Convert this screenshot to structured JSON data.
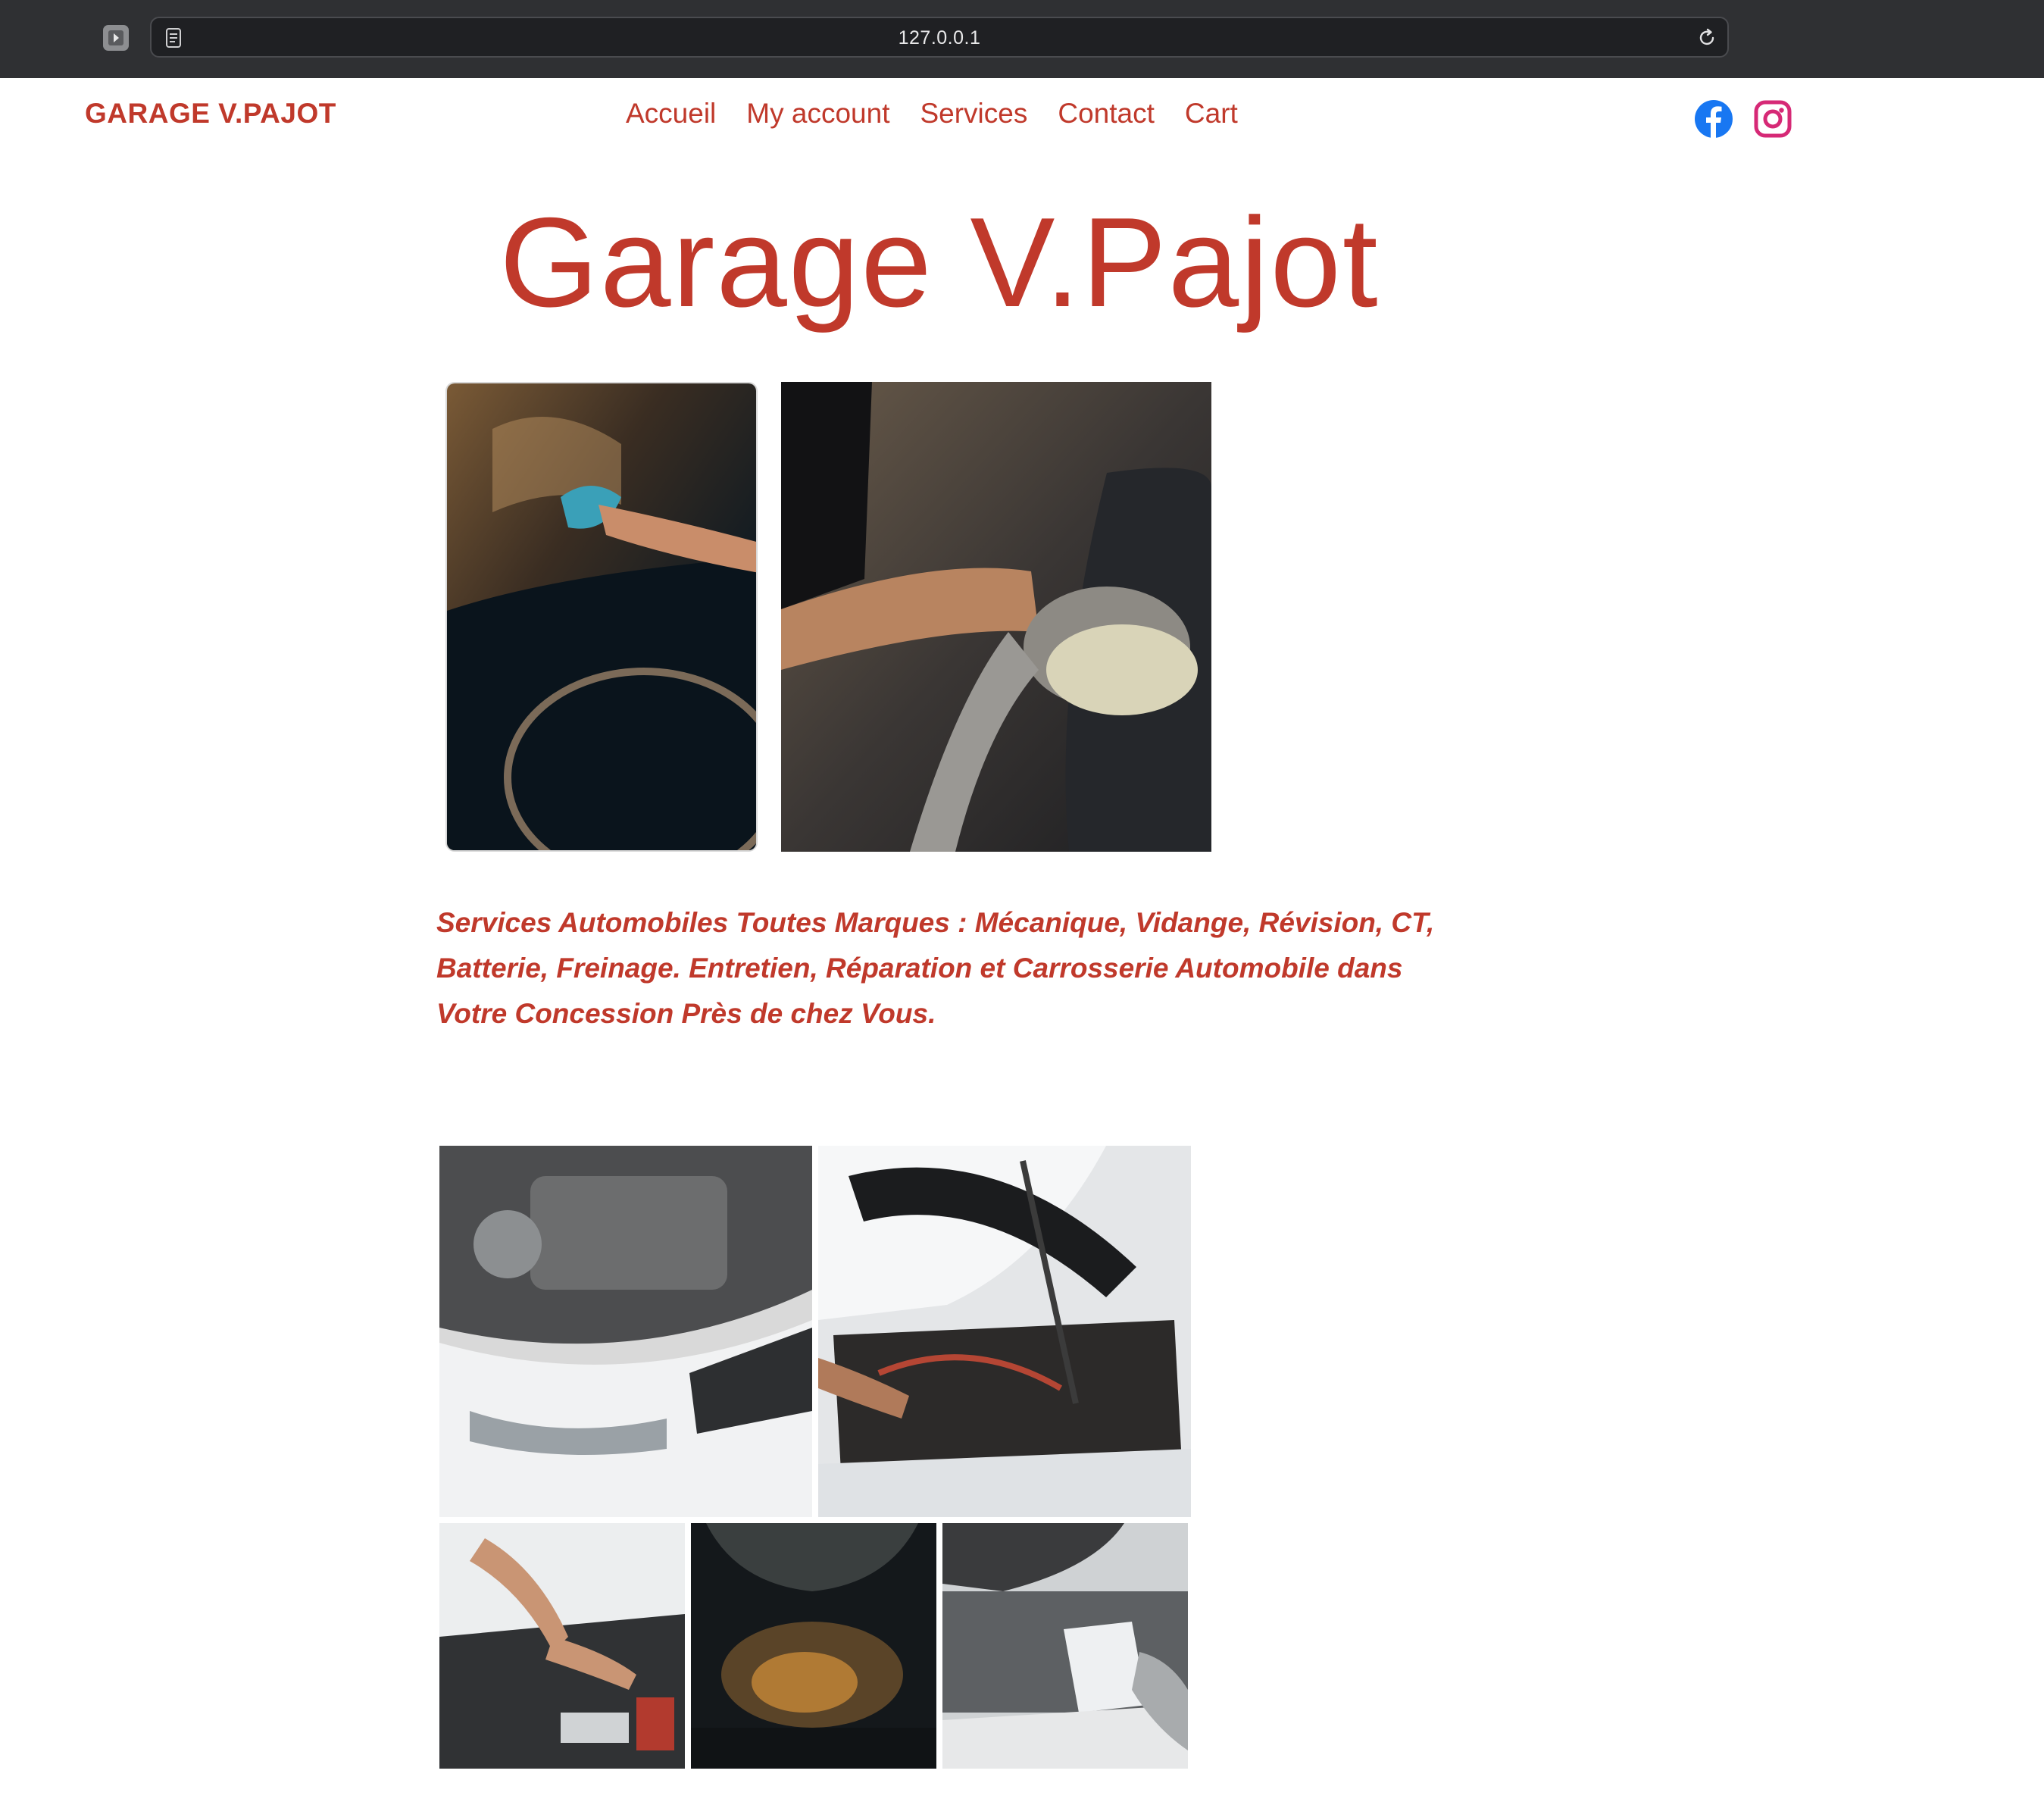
{
  "browser": {
    "url": "127.0.0.1",
    "icons": [
      "shield-icon",
      "reader-icon",
      "reload-icon"
    ]
  },
  "nav": {
    "logo": "GARAGE V.PAJOT",
    "links": [
      "Accueil",
      "My account",
      "Services",
      "Contact",
      "Cart"
    ],
    "social": [
      "facebook-icon",
      "instagram-icon"
    ]
  },
  "hero": {
    "title": "Garage V.Pajot"
  },
  "tagline": "Services Automobiles Toutes Marques : Mécanique, Vidange, Révision, CT, Batterie, Freinage. Entretien, Réparation et Carrosserie Automobile dans Votre Concession Près de chez Vous.",
  "colors": {
    "brand": "#c0392b",
    "browser_chrome": "#2f3033",
    "facebook": "#1877f2",
    "instagram": "#d62976"
  }
}
